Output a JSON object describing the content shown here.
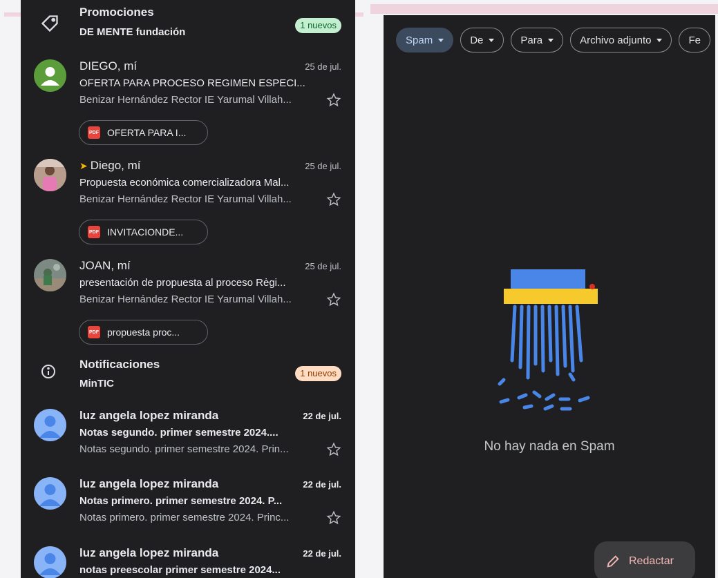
{
  "left": {
    "promo": {
      "title": "Promociones",
      "subtitle": "DE MENTE fundación",
      "badge": "1 nuevos",
      "icon": "label-icon"
    },
    "mails_top": [
      {
        "sender": "DIEGO, mí",
        "date": "25 de jul.",
        "subject": "OFERTA PARA PROCESO REGIMEN ESPECI...",
        "snippet": "Benizar Hernández Rector IE Yarumal Villah...",
        "attachment": "OFERTA PARA I...",
        "avatar": "default-person-green"
      },
      {
        "sender": "Diego, mí",
        "date": "25 de jul.",
        "subject": "Propuesta económica comercializadora Mal...",
        "snippet": "Benizar Hernández Rector IE Yarumal Villah...",
        "attachment": "INVITACIONDE...",
        "avatar": "photo-person"
      },
      {
        "sender": "JOAN, mí",
        "date": "25 de jul.",
        "subject": "presentación de propuesta al proceso Rėgi...",
        "snippet": "Benizar Hernández Rector IE Yarumal Villah...",
        "attachment": "propuesta proc...",
        "avatar": "photo-outdoor"
      }
    ],
    "notif": {
      "title": "Notificaciones",
      "subtitle": "MinTIC",
      "badge": "1 nuevos",
      "icon": "info-icon"
    },
    "mails_bottom": [
      {
        "sender": "luz angela lopez miranda",
        "date": "22 de jul.",
        "subject": "Notas segundo. primer semestre 2024....",
        "snippet": "Notas segundo. primer semestre 2024. Prin..."
      },
      {
        "sender": "luz angela lopez miranda",
        "date": "22 de jul.",
        "subject": "Notas primero. primer semestre 2024. P...",
        "snippet": "Notas primero. primer semestre 2024. Princ..."
      },
      {
        "sender": "luz angela lopez miranda",
        "date": "22 de jul.",
        "subject": "notas preescolar primer semestre 2024...",
        "snippet": ""
      }
    ]
  },
  "right": {
    "filters": [
      "Spam",
      "De",
      "Para",
      "Archivo adjunto",
      "Fe"
    ],
    "empty_message": "No hay nada en Spam",
    "compose_label": "Redactar"
  },
  "colors": {
    "panel_bg": "#1f1f21",
    "shredder_paper": "#4a86e8",
    "shredder_body": "#f6c92c",
    "compose_text": "#f2b8b5"
  }
}
